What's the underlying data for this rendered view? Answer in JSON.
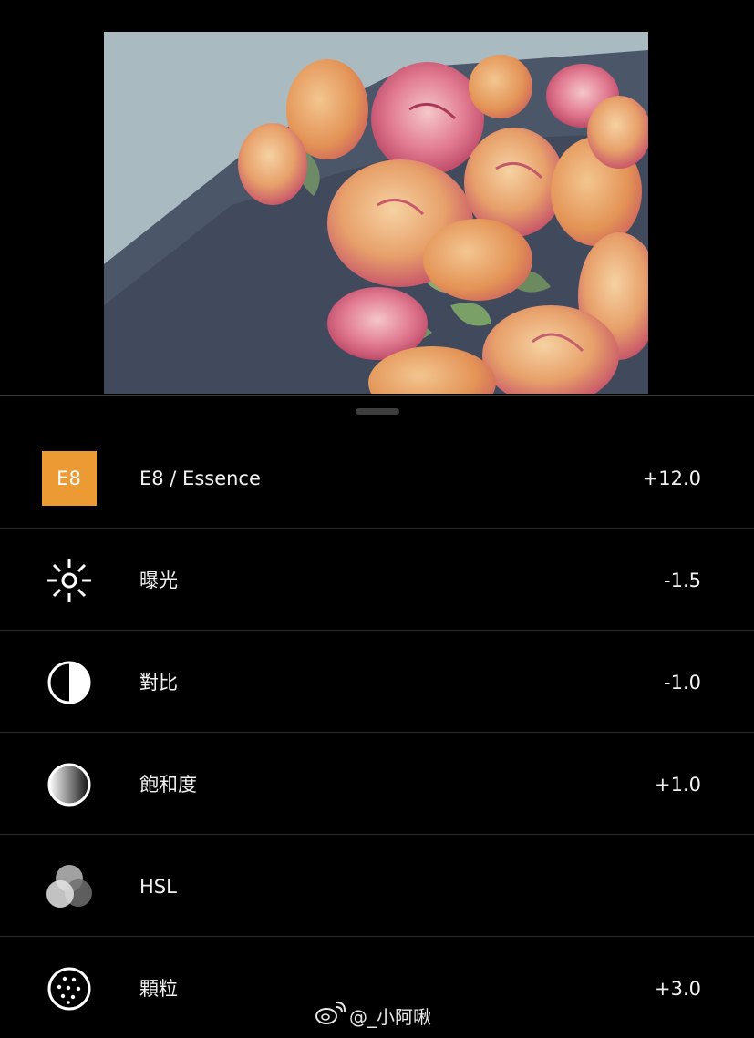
{
  "colors": {
    "background": "#000000",
    "accent": "#ec9a34",
    "text": "#f2f2f2",
    "divider": "#2b2b2b"
  },
  "tools": [
    {
      "icon": "preset-e8-badge",
      "badge": "E8",
      "label": "E8 / Essence",
      "value": "+12.0"
    },
    {
      "icon": "exposure-sun-icon",
      "label": "曝光",
      "value": "-1.5"
    },
    {
      "icon": "contrast-icon",
      "label": "對比",
      "value": "-1.0"
    },
    {
      "icon": "saturation-icon",
      "label": "飽和度",
      "value": "+1.0"
    },
    {
      "icon": "hsl-circles-icon",
      "label": "HSL",
      "value": ""
    },
    {
      "icon": "grain-icon",
      "label": "顆粒",
      "value": "+3.0"
    }
  ],
  "watermark": {
    "icon": "weibo-icon",
    "text": "@_小阿啾"
  }
}
